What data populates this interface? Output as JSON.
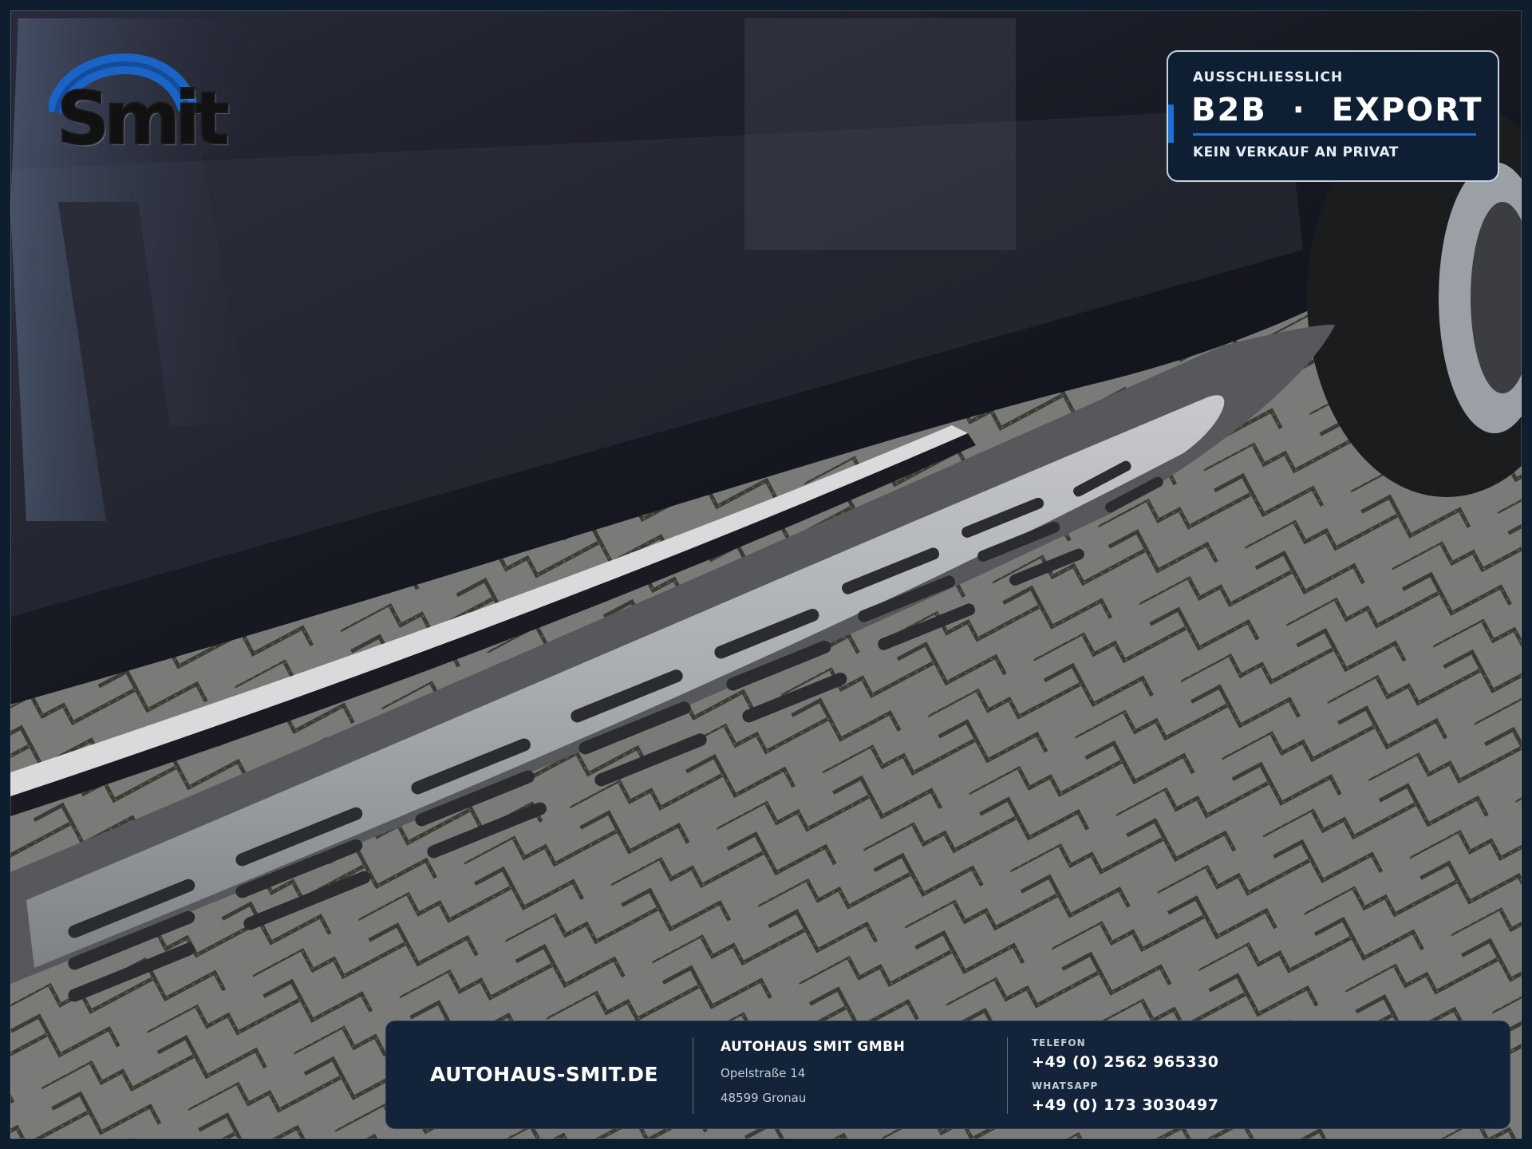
{
  "logo": {
    "wordmark": "Smit",
    "arc_color": "#1a63c7"
  },
  "badge": {
    "kicker": "AUSSCHLIESSLICH",
    "title": "B2B  ·  EXPORT",
    "subtitle": "KEIN VERKAUF AN PRIVAT",
    "accent_color": "#1d6fd6",
    "background_color": "#0f1f33"
  },
  "footer": {
    "website": "AUTOHAUS-SMIT.DE",
    "company": "AUTOHAUS SMIT GMBH",
    "address_line1": "Opelstraße 14",
    "address_line2": "48599 Gronau",
    "phone_label": "TELEFON",
    "phone": "+49 (0) 2562 965330",
    "whatsapp_label": "WHATSAPP",
    "whatsapp": "+49 (0) 173 3030497",
    "background_color": "#13243a"
  },
  "photo": {
    "subject": "car-side-running-board",
    "icons": [
      "smit-logo-icon"
    ]
  }
}
